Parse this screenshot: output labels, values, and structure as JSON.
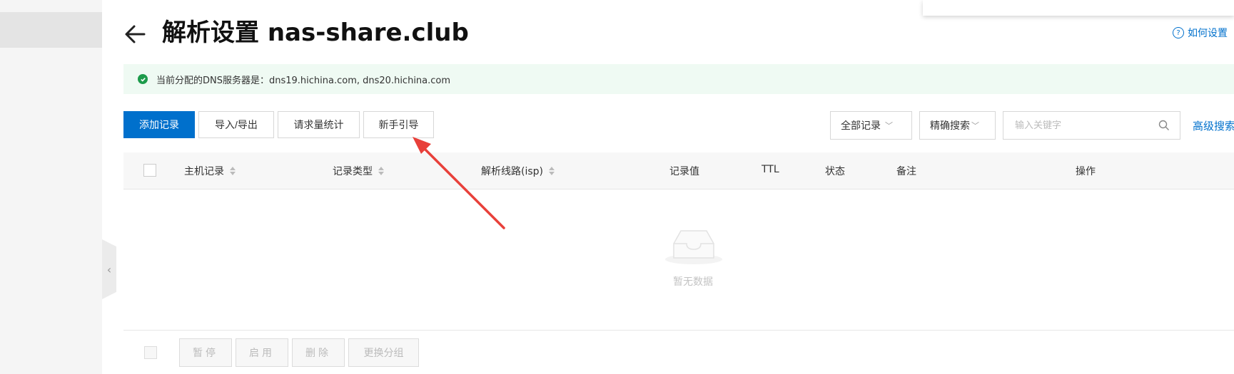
{
  "header": {
    "title": "解析设置 nas-share.club",
    "help_link": "如何设置"
  },
  "notice": {
    "text": "当前分配的DNS服务器是：dns19.hichina.com, dns20.hichina.com"
  },
  "toolbar": {
    "add_record": "添加记录",
    "import_export": "导入/导出",
    "request_stats": "请求量统计",
    "beginner_guide": "新手引导",
    "record_filter": "全部记录",
    "search_mode": "精确搜索",
    "search_placeholder": "输入关键字",
    "advanced_search": "高级搜索"
  },
  "table": {
    "columns": [
      "主机记录",
      "记录类型",
      "解析线路(isp)",
      "记录值",
      "TTL",
      "状态",
      "备注",
      "操作"
    ],
    "empty_text": "暂无数据"
  },
  "batch_actions": {
    "pause": "暂停",
    "enable": "启用",
    "delete": "删除",
    "change_group": "更换分组"
  },
  "colors": {
    "primary": "#0070cc",
    "success": "#1d9b4b",
    "annotation_arrow": "#e8403a"
  }
}
